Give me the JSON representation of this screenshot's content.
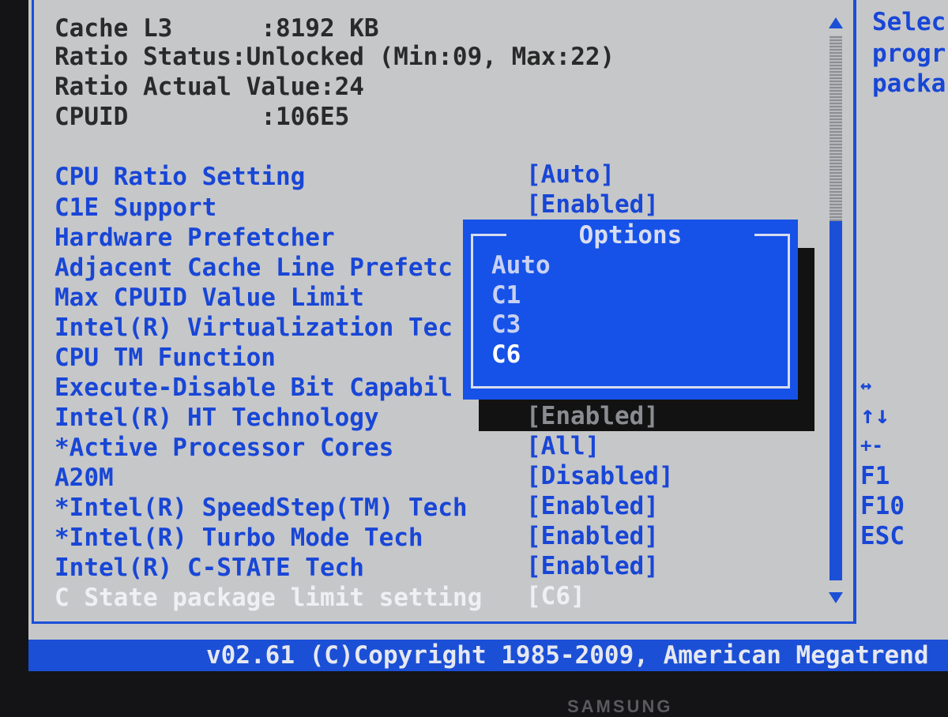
{
  "info": {
    "cache_l3": "Cache L3      :8192 KB",
    "ratio_status": "Ratio Status:Unlocked (Min:09, Max:22)",
    "ratio_actual": "Ratio Actual Value:24",
    "cpuid": "CPUID         :106E5"
  },
  "settings": [
    {
      "label": "CPU Ratio Setting",
      "value": "[Auto]"
    },
    {
      "label": "C1E Support",
      "value": "[Enabled]"
    },
    {
      "label": "Hardware Prefetcher",
      "value": ""
    },
    {
      "label": "Adjacent Cache Line Prefetc",
      "value": ""
    },
    {
      "label": "Max CPUID Value Limit",
      "value": ""
    },
    {
      "label": "Intel(R) Virtualization Tec",
      "value": ""
    },
    {
      "label": "CPU TM Function",
      "value": ""
    },
    {
      "label": "Execute-Disable Bit Capabil",
      "value": ""
    },
    {
      "label": "Intel(R) HT Technology",
      "value": "[Enabled]"
    },
    {
      "label": "*Active Processor Cores",
      "value": "[All]"
    },
    {
      "label": "A20M",
      "value": "[Disabled]"
    },
    {
      "label": "*Intel(R) SpeedStep(TM) Tech",
      "value": "[Enabled]"
    },
    {
      "label": "*Intel(R) Turbo Mode Tech",
      "value": "[Enabled]"
    },
    {
      "label": "Intel(R) C-STATE Tech",
      "value": "[Enabled]"
    },
    {
      "label": "C State package limit setting",
      "value": "[C6]"
    }
  ],
  "popup": {
    "title": "Options",
    "options": [
      "Auto",
      "C1",
      "C3",
      "C6"
    ],
    "selected": "C6"
  },
  "help": {
    "lines": [
      "Selec",
      "progr",
      "packa"
    ]
  },
  "keys": [
    "↔",
    "↑↓",
    "+-",
    "F1",
    "F10",
    "ESC"
  ],
  "footer": {
    "copyright": "v02.61 (C)Copyright 1985-2009, American Megatrend"
  },
  "monitor_brand": "SAMSUNG"
}
